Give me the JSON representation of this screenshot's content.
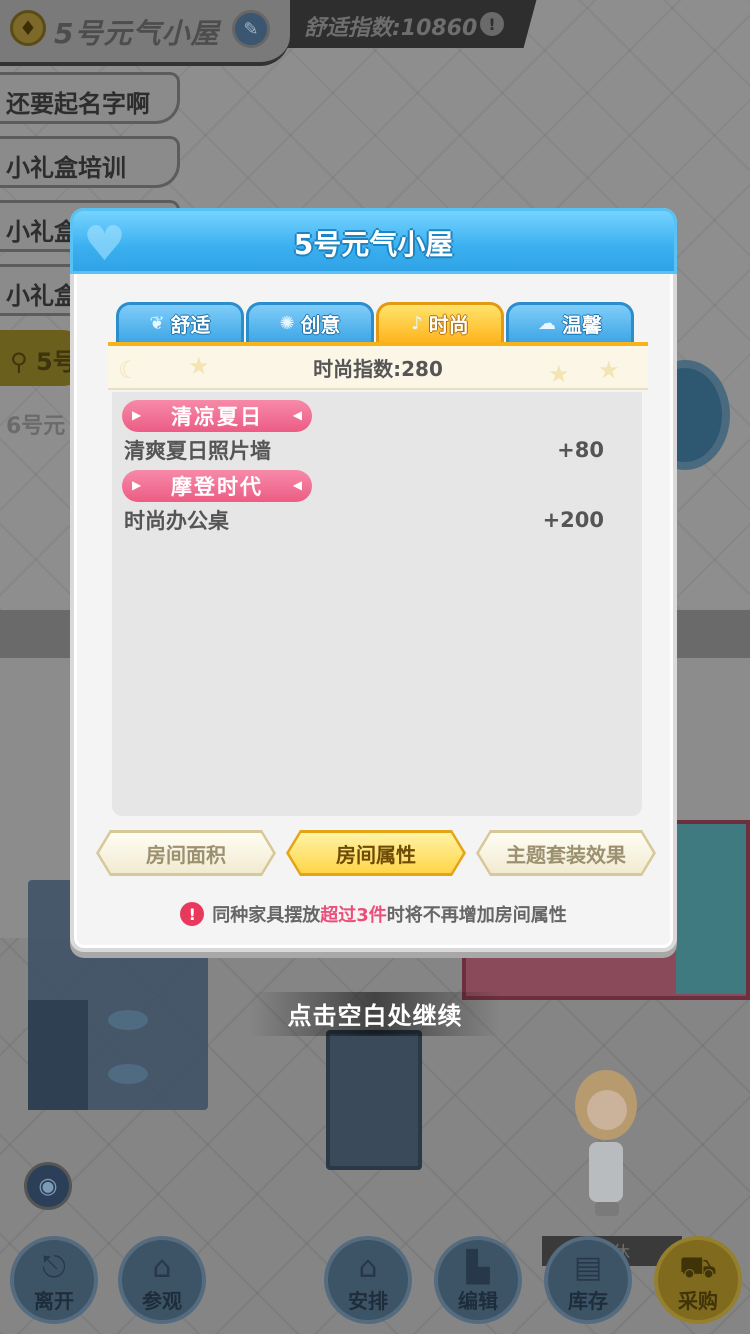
{
  "header": {
    "room_name": "5号元气小屋",
    "comfort_index": "舒适指数:10860"
  },
  "room_list": [
    "还要起名字啊",
    "小礼盒培训",
    "小礼盒",
    "小礼盒"
  ],
  "location_tag": "5号",
  "room_6_label": "6号元",
  "continue_hint": "点击空白处继续",
  "rest_tag": "休",
  "toolbar": [
    {
      "label": "离开",
      "icon": "door-icon"
    },
    {
      "label": "参观",
      "icon": "visit-icon"
    },
    {
      "label": "安排",
      "icon": "home-icon"
    },
    {
      "label": "编辑",
      "icon": "edit-icon"
    },
    {
      "label": "库存",
      "icon": "storage-icon"
    },
    {
      "label": "采购",
      "icon": "truck-icon"
    }
  ],
  "modal": {
    "title": "5号元气小屋",
    "tabs": [
      {
        "label": "舒适",
        "icon": "sprout-icon"
      },
      {
        "label": "创意",
        "icon": "bulb-icon"
      },
      {
        "label": "时尚",
        "icon": "shoe-icon",
        "active": true
      },
      {
        "label": "温馨",
        "icon": "heart-cloud-icon"
      }
    ],
    "index_text": "时尚指数:280",
    "groups": [
      {
        "name": "清凉夏日",
        "items": [
          {
            "name": "清爽夏日照片墙",
            "value": "+80"
          }
        ]
      },
      {
        "name": "摩登时代",
        "items": [
          {
            "name": "时尚办公桌",
            "value": "+200"
          }
        ]
      }
    ],
    "buttons": [
      {
        "label": "房间面积",
        "active": false
      },
      {
        "label": "房间属性",
        "active": true
      },
      {
        "label": "主题套装效果",
        "active": false
      }
    ],
    "notice": {
      "prefix": "同种家具摆放",
      "highlight": "超过3件",
      "suffix": "时将不再增加房间属性"
    }
  },
  "colors": {
    "title_blue": "#3ab0f0",
    "tab_active": "#ffb51e",
    "group_pink": "#ec5c85",
    "highlight_pink": "#ec4e7a"
  }
}
